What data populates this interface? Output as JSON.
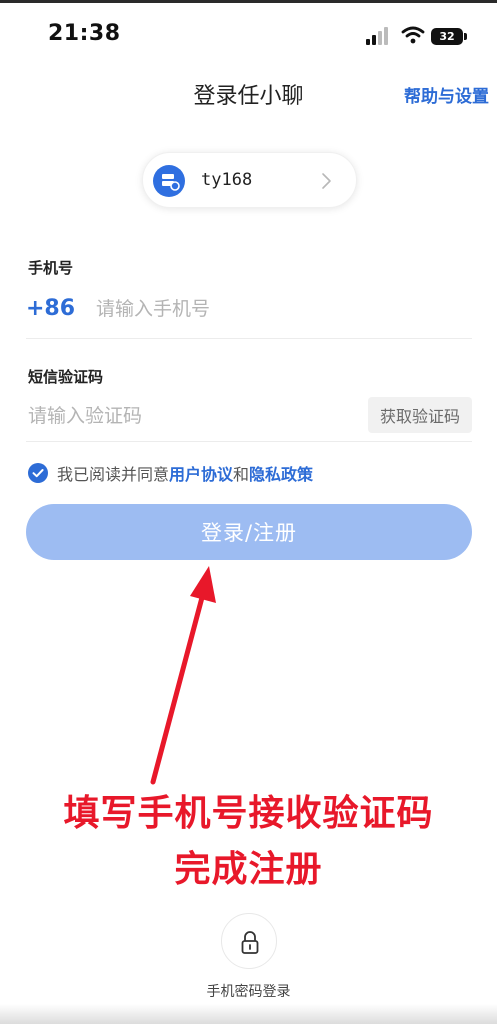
{
  "status_bar": {
    "time": "21:38",
    "battery": "32"
  },
  "nav": {
    "title": "登录任小聊",
    "help_link": "帮助与设置"
  },
  "account": {
    "name": "ty168"
  },
  "phone": {
    "label": "手机号",
    "country_code": "+86",
    "placeholder": "请输入手机号"
  },
  "sms": {
    "label": "短信验证码",
    "placeholder": "请输入验证码",
    "get_code_label": "获取验证码"
  },
  "agreement": {
    "checked": true,
    "prefix": "我已阅读并同意",
    "terms_link": "用户协议",
    "conjunction": "和",
    "privacy_link": "隐私政策"
  },
  "login_button": {
    "label": "登录/注册"
  },
  "annotation": {
    "line1": "填写手机号接收验证码",
    "line2": "完成注册"
  },
  "alt_login": {
    "label": "手机密码登录"
  },
  "colors": {
    "accent": "#2d6cd6",
    "button_disabled": "#9dbcf2",
    "annotation": "#e8182a"
  }
}
